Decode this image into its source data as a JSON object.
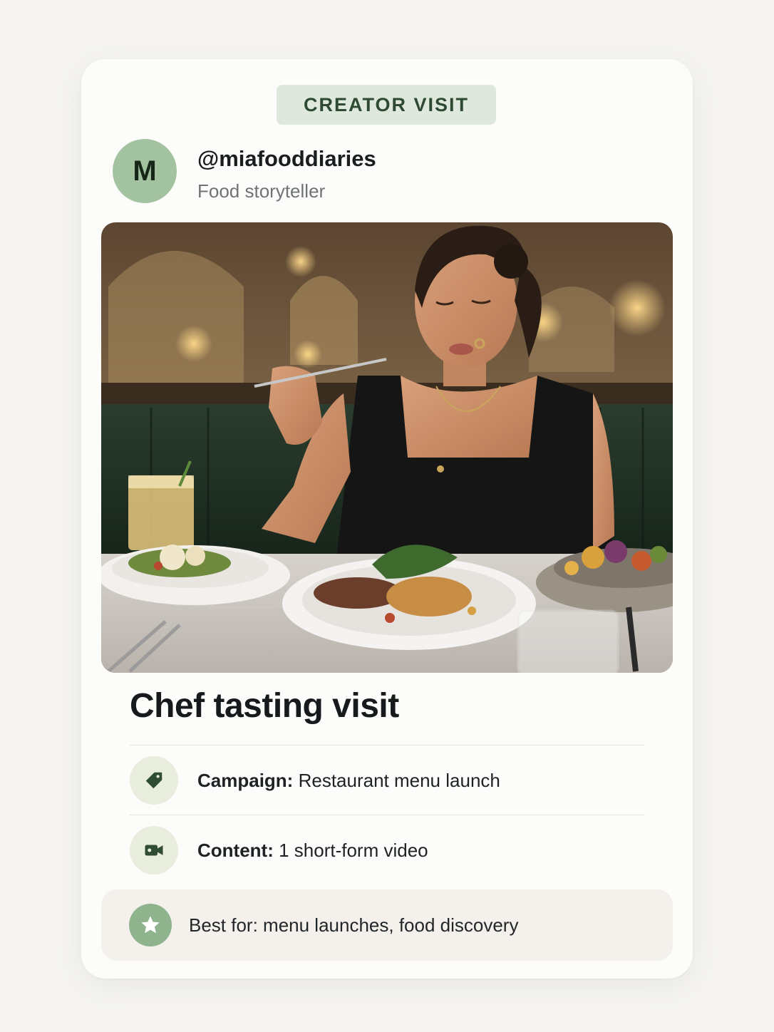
{
  "badge": {
    "label": "CREATOR VISIT"
  },
  "creator": {
    "avatar_initial": "M",
    "handle": "@miafooddiaries",
    "role": "Food storyteller"
  },
  "post": {
    "title": "Chef tasting visit",
    "photo_alt": "Creator tasting a dish at a restaurant table"
  },
  "details": [
    {
      "key": "Campaign:",
      "value": "Restaurant menu launch",
      "icon": "tag-icon"
    },
    {
      "key": "Content:",
      "value": "1 short-form video",
      "icon": "video-camera-icon"
    }
  ],
  "best_for": {
    "text": "Best for: menu launches, food discovery",
    "icon": "star-icon"
  },
  "colors": {
    "badge_bg": "#dfe8dc",
    "badge_text": "#2e4a33",
    "avatar_bg": "#a3c3a0",
    "icon_circle_bg": "#e9eddd",
    "icon_color": "#2f4d35",
    "star_circle_bg": "#8fb38d",
    "best_for_bg": "#f4f1ed"
  }
}
